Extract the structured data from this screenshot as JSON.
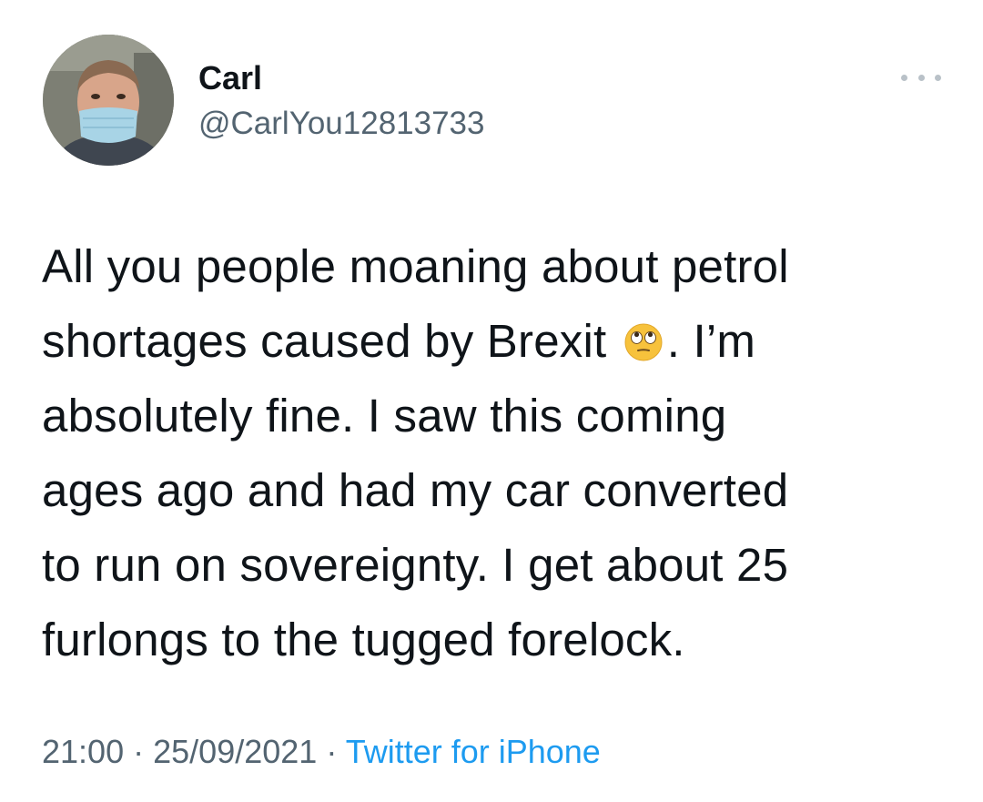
{
  "user": {
    "display_name": "Carl",
    "handle": "@CarlYou12813733"
  },
  "tweet": {
    "lines": [
      "All you people moaning about petrol",
      "shortages caused by Brexit",
      ". I’m",
      "absolutely fine. I saw this coming",
      "ages ago and had my car converted",
      "to run on sovereignty. I get about 25",
      "furlongs to the tugged forelock."
    ],
    "emoji": "face-with-rolling-eyes-icon"
  },
  "meta": {
    "time": "21:00",
    "separator": "·",
    "date": "25/09/2021",
    "source": "Twitter for iPhone"
  },
  "colors": {
    "text": "#0f1419",
    "secondary": "#536471",
    "link": "#1d9bf0",
    "mask": "#a8d4e6"
  }
}
